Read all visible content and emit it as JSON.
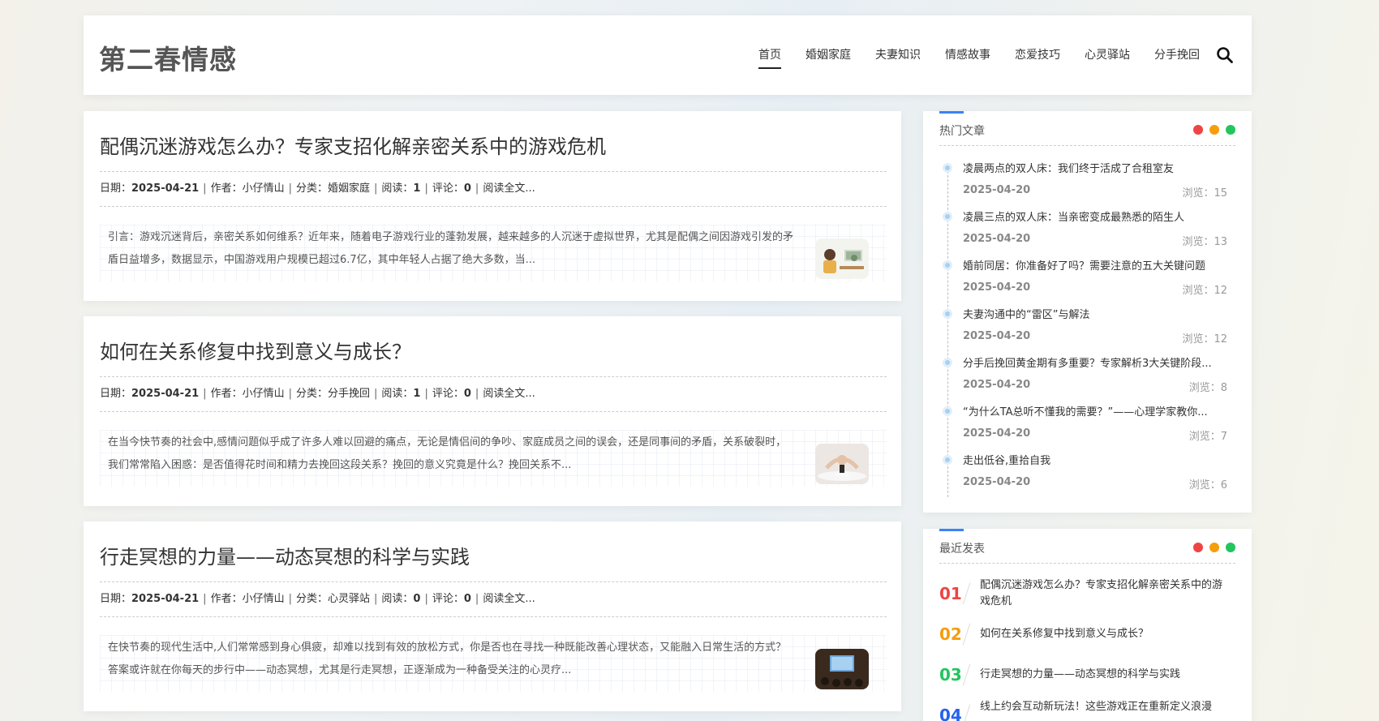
{
  "site": {
    "title": "第二春情感"
  },
  "nav": {
    "items": [
      {
        "label": "首页",
        "active": true
      },
      {
        "label": "婚姻家庭",
        "active": false
      },
      {
        "label": "夫妻知识",
        "active": false
      },
      {
        "label": "情感故事",
        "active": false
      },
      {
        "label": "恋爱技巧",
        "active": false
      },
      {
        "label": "心灵驿站",
        "active": false
      },
      {
        "label": "分手挽回",
        "active": false
      }
    ],
    "search_icon": "search-icon"
  },
  "articles": [
    {
      "title": "配偶沉迷游戏怎么办？专家支招化解亲密关系中的游戏危机",
      "date_label": "日期：",
      "date": "2025-04-21",
      "author_label": "作者：",
      "author": "小仔情山",
      "category_label": "分类：",
      "category": "婚姻家庭",
      "reads_label": "阅读：",
      "reads": "1",
      "comments_label": "评论：",
      "comments": "0",
      "read_more": "阅读全文...",
      "excerpt": "引言：游戏沉迷背后，亲密关系如何维系？近年来，随着电子游戏行业的蓬勃发展，越来越多的人沉迷于虚拟世界，尤其是配偶之间因游戏引发的矛盾日益增多，数据显示，中国游戏用户规模已超过6.7亿，其中年轻人占据了绝大多数，当..."
    },
    {
      "title": "如何在关系修复中找到意义与成长？",
      "date_label": "日期：",
      "date": "2025-04-21",
      "author_label": "作者：",
      "author": "小仔情山",
      "category_label": "分类：",
      "category": "分手挽回",
      "reads_label": "阅读：",
      "reads": "1",
      "comments_label": "评论：",
      "comments": "0",
      "read_more": "阅读全文...",
      "excerpt": "在当今快节奏的社会中,感情问题似乎成了许多人难以回避的痛点，无论是情侣间的争吵、家庭成员之间的误会，还是同事间的矛盾，关系破裂时，我们常常陷入困惑：是否值得花时间和精力去挽回这段关系？挽回的意义究竟是什么？挽回关系不..."
    },
    {
      "title": "行走冥想的力量——动态冥想的科学与实践",
      "date_label": "日期：",
      "date": "2025-04-21",
      "author_label": "作者：",
      "author": "小仔情山",
      "category_label": "分类：",
      "category": "心灵驿站",
      "reads_label": "阅读：",
      "reads": "0",
      "comments_label": "评论：",
      "comments": "0",
      "read_more": "阅读全文...",
      "excerpt": "在快节奏的现代生活中,人们常常感到身心俱疲，却难以找到有效的放松方式，你是否也在寻找一种既能改善心理状态，又能融入日常生活的方式？答案或许就在你每天的步行中——动态冥想，尤其是行走冥想，正逐渐成为一种备受关注的心灵疗..."
    }
  ],
  "hot": {
    "title": "热门文章",
    "dot_colors": [
      "#ef4444",
      "#f59e0b",
      "#22c55e"
    ],
    "items": [
      {
        "title": "凌晨两点的双人床：我们终于活成了合租室友",
        "date": "2025-04-20",
        "views": "浏览：15"
      },
      {
        "title": "凌晨三点的双人床：当亲密变成最熟悉的陌生人",
        "date": "2025-04-20",
        "views": "浏览：13"
      },
      {
        "title": "婚前同居：你准备好了吗？需要注意的五大关键问题",
        "date": "2025-04-20",
        "views": "浏览：12"
      },
      {
        "title": "夫妻沟通中的“雷区”与解法",
        "date": "2025-04-20",
        "views": "浏览：12"
      },
      {
        "title": "分手后挽回黄金期有多重要？专家解析3大关键阶段...",
        "date": "2025-04-20",
        "views": "浏览：8"
      },
      {
        "title": "“为什么TA总听不懂我的需要？”——心理学家教你...",
        "date": "2025-04-20",
        "views": "浏览：7"
      },
      {
        "title": "走出低谷,重拾自我",
        "date": "2025-04-20",
        "views": "浏览：6"
      }
    ]
  },
  "recent": {
    "title": "最近发表",
    "items": [
      {
        "num": "01",
        "color": "#ef4444",
        "title": "配偶沉迷游戏怎么办？专家支招化解亲密关系中的游戏危机"
      },
      {
        "num": "02",
        "color": "#f59e0b",
        "title": "如何在关系修复中找到意义与成长？"
      },
      {
        "num": "03",
        "color": "#22c55e",
        "title": "行走冥想的力量——动态冥想的科学与实践"
      },
      {
        "num": "04",
        "color": "#2563eb",
        "title": "线上约会互动新玩法！这些游戏正在重新定义浪漫"
      }
    ]
  }
}
